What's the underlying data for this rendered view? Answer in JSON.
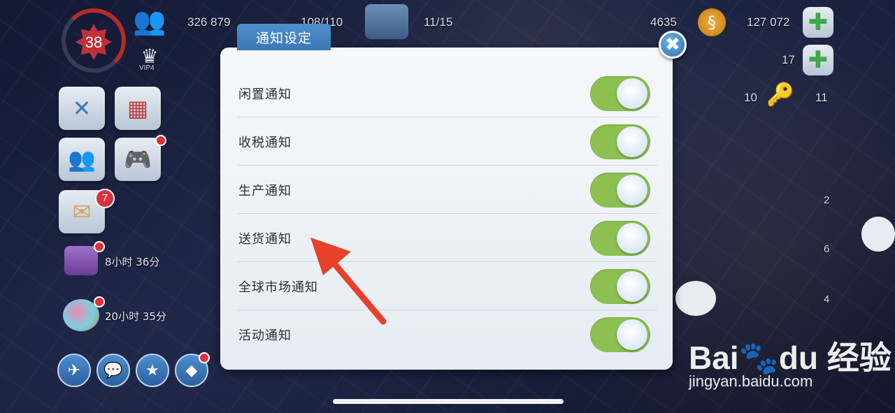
{
  "hud": {
    "level": "38",
    "population": "326 879",
    "storage": "108/110",
    "trade_slots": "11/15",
    "simcash": "4635",
    "simoleons": "127 072",
    "side_count_1": "17",
    "keys_count_1": "10",
    "keys_count_2": "11",
    "vip_label": "VIP4"
  },
  "left_panel": {
    "mail_badge": "7",
    "timers": [
      {
        "text": "8小时 36分"
      },
      {
        "text": "20小时 35分"
      }
    ]
  },
  "map_counts": [
    "2",
    "6",
    "4"
  ],
  "dialog": {
    "title": "通知设定",
    "close_icon": "✖",
    "settings": [
      {
        "label": "闲置通知",
        "enabled": true
      },
      {
        "label": "收税通知",
        "enabled": true
      },
      {
        "label": "生产通知",
        "enabled": true
      },
      {
        "label": "送货通知",
        "enabled": true
      },
      {
        "label": "全球市场通知",
        "enabled": true
      },
      {
        "label": "活动通知",
        "enabled": true
      }
    ]
  },
  "colors": {
    "toggle_on": "#8cc152",
    "tab_blue": "#3b78b4",
    "arrow_red": "#e8402a"
  },
  "watermark": {
    "logo": "Bai🐾du 经验",
    "url": "jingyan.baidu.com"
  }
}
